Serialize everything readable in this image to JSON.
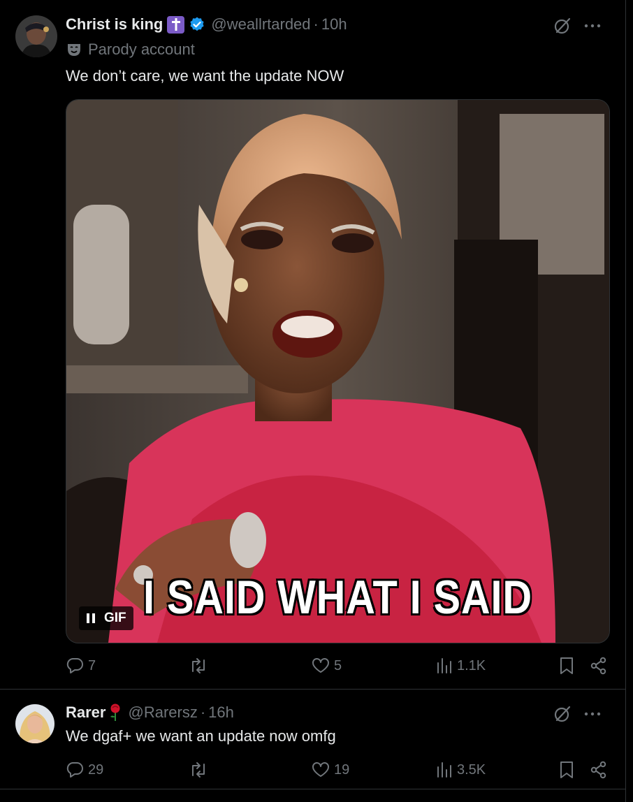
{
  "tweet1": {
    "display_name": "Christ is king",
    "handle": "@weallrtarded",
    "separator": "·",
    "time": "10h",
    "parody_label": "Parody account",
    "text": "We don’t care, we want the update NOW",
    "gif": {
      "caption": "I SAID WHAT I SAID",
      "badge_label": "GIF"
    },
    "actions": {
      "replies": "7",
      "retweets": "",
      "likes": "5",
      "views": "1.1K"
    }
  },
  "tweet2": {
    "display_name": "Rarer",
    "handle": "@Rarersz",
    "separator": "·",
    "time": "16h",
    "text": "We dgaf+ we want an update now omfg",
    "actions": {
      "replies": "29",
      "retweets": "",
      "likes": "19",
      "views": "3.5K"
    }
  },
  "colors": {
    "background": "#000000",
    "text": "#e7e9ea",
    "muted": "#71767b",
    "verified": "#1d9bf0",
    "divider": "#2f3336",
    "cross_badge": "#7b5bc7"
  }
}
